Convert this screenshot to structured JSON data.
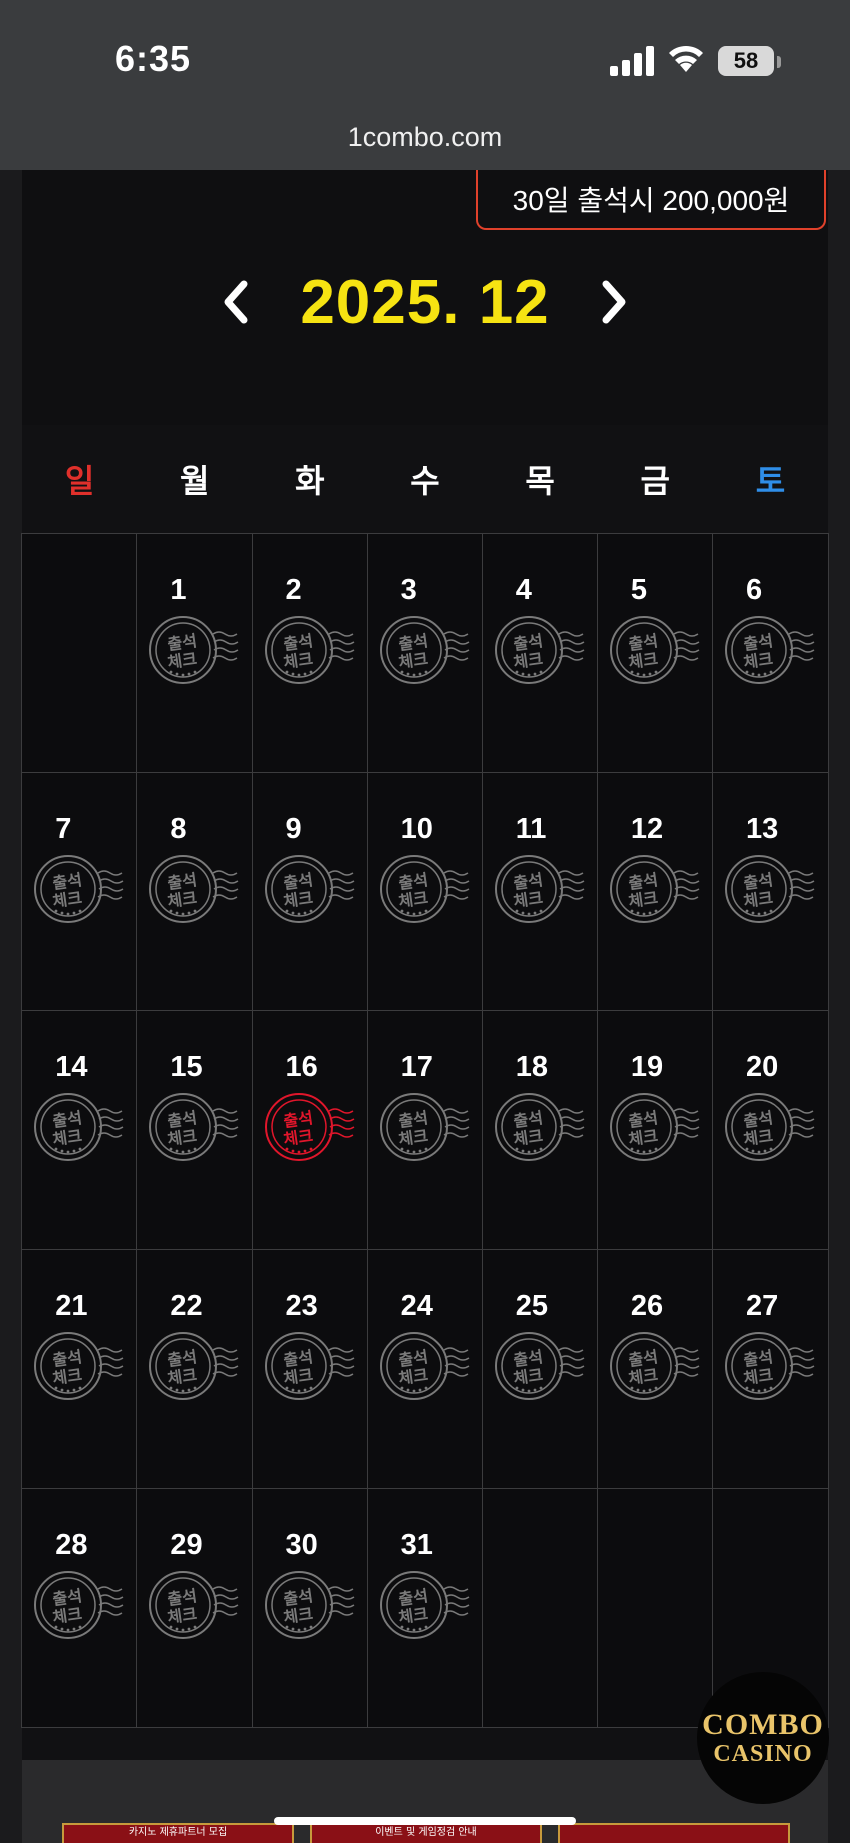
{
  "status_bar": {
    "time": "6:35",
    "battery": "58"
  },
  "browser": {
    "url": "1combo.com"
  },
  "attendance": {
    "reward_text": "30일 출석시 200,000원",
    "month_title": "2025. 12",
    "weekdays": [
      "일",
      "월",
      "화",
      "수",
      "목",
      "금",
      "토"
    ],
    "stamp_text_top": "출석",
    "stamp_text_bottom": "체크",
    "stamp_colors": {
      "normal": "#7a7a7a",
      "checked": "#e0162b"
    },
    "weeks": [
      [
        null,
        "1",
        "2",
        "3",
        "4",
        "5",
        "6"
      ],
      [
        "7",
        "8",
        "9",
        "10",
        "11",
        "12",
        "13"
      ],
      [
        "14",
        "15",
        "16",
        "17",
        "18",
        "19",
        "20"
      ],
      [
        "21",
        "22",
        "23",
        "24",
        "25",
        "26",
        "27"
      ],
      [
        "28",
        "29",
        "30",
        "31",
        null,
        null,
        null
      ]
    ],
    "checked_days": [
      "16"
    ]
  },
  "badge": {
    "line1": "COMBO",
    "line2": "CASINO"
  },
  "banners": [
    "카지노 제휴파트너 모집",
    "이벤트 및 게임정검 안내",
    ""
  ]
}
